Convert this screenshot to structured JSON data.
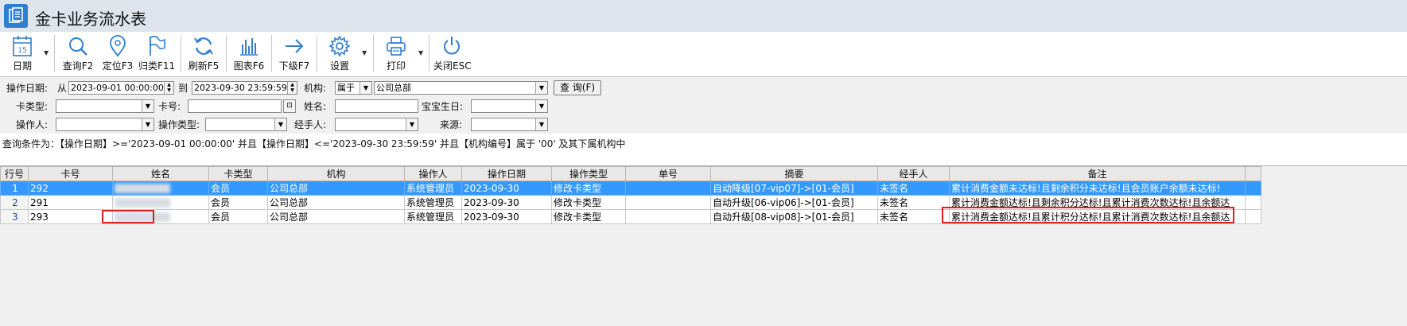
{
  "window": {
    "title": "金卡业务流水表"
  },
  "toolbar": {
    "buttons": [
      {
        "label": "日期",
        "icon": "calendar-icon",
        "icon_text": "15"
      },
      {
        "label": "查询F2",
        "icon": "search-icon"
      },
      {
        "label": "定位F3",
        "icon": "location-pin-icon"
      },
      {
        "label": "归类F11",
        "icon": "flag-icon"
      },
      {
        "label": "刷新F5",
        "icon": "refresh-icon"
      },
      {
        "label": "图表F6",
        "icon": "bar-chart-icon"
      },
      {
        "label": "下级F7",
        "icon": "arrow-right-icon"
      },
      {
        "label": "设置",
        "icon": "gear-icon"
      },
      {
        "label": "打印",
        "icon": "printer-icon"
      },
      {
        "label": "关闭ESC",
        "icon": "power-icon"
      }
    ]
  },
  "filter": {
    "op_date_label": "操作日期:",
    "from_label": "从",
    "date_from": "2023-09-01 00:00:00",
    "to_label": "到",
    "date_to": "2023-09-30 23:59:59",
    "org_label": "机构:",
    "org_mode": "属于",
    "org_value": "公司总部",
    "query_button": "查 询(F)",
    "card_type_label": "卡类型:",
    "card_no_label": "卡号:",
    "name_label": "姓名:",
    "baby_birthday_label": "宝宝生日:",
    "operator_label": "操作人:",
    "op_type_label": "操作类型:",
    "handler_label": "经手人:",
    "source_label": "来源:"
  },
  "condition_text": "查询条件为：【操作日期】>='2023-09-01 00:00:00' 并且【操作日期】<='2023-09-30 23:59:59' 并且【机构编号】属于 '00' 及其下属机构中",
  "table": {
    "headers": [
      "行号",
      "卡号",
      "姓名",
      "卡类型",
      "机构",
      "操作人",
      "操作日期",
      "操作类型",
      "单号",
      "摘要",
      "经手人",
      "备注"
    ],
    "rows": [
      {
        "row": "1",
        "card": "292",
        "type": "会员",
        "org": "公司总部",
        "operator": "系统管理员",
        "date": "2023-09-30",
        "op_type": "修改卡类型",
        "order": "",
        "summary": "自动降级[07-vip07]->[01-会员]",
        "handler": "未签名",
        "remark": "累计消费金额未达标!且剩余积分未达标!且会员账户余额未达标!"
      },
      {
        "row": "2",
        "card": "291",
        "type": "会员",
        "org": "公司总部",
        "operator": "系统管理员",
        "date": "2023-09-30",
        "op_type": "修改卡类型",
        "order": "",
        "summary": "自动升级[06-vip06]->[01-会员]",
        "handler": "未签名",
        "remark": "累计消费金额达标!且剩余积分达标!且累计消费次数达标!且余额达"
      },
      {
        "row": "3",
        "card": "293",
        "type": "会员",
        "org": "公司总部",
        "operator": "系统管理员",
        "date": "2023-09-30",
        "op_type": "修改卡类型",
        "order": "",
        "summary": "自动升级[08-vip08]->[01-会员]",
        "handler": "未签名",
        "remark": "累计消费金额达标!且累计积分达标!且累计消费次数达标!且余额达"
      }
    ]
  },
  "colors": {
    "selection": "#3399ff",
    "highlight": "#e02020",
    "titlebar": "#dde4ec"
  }
}
